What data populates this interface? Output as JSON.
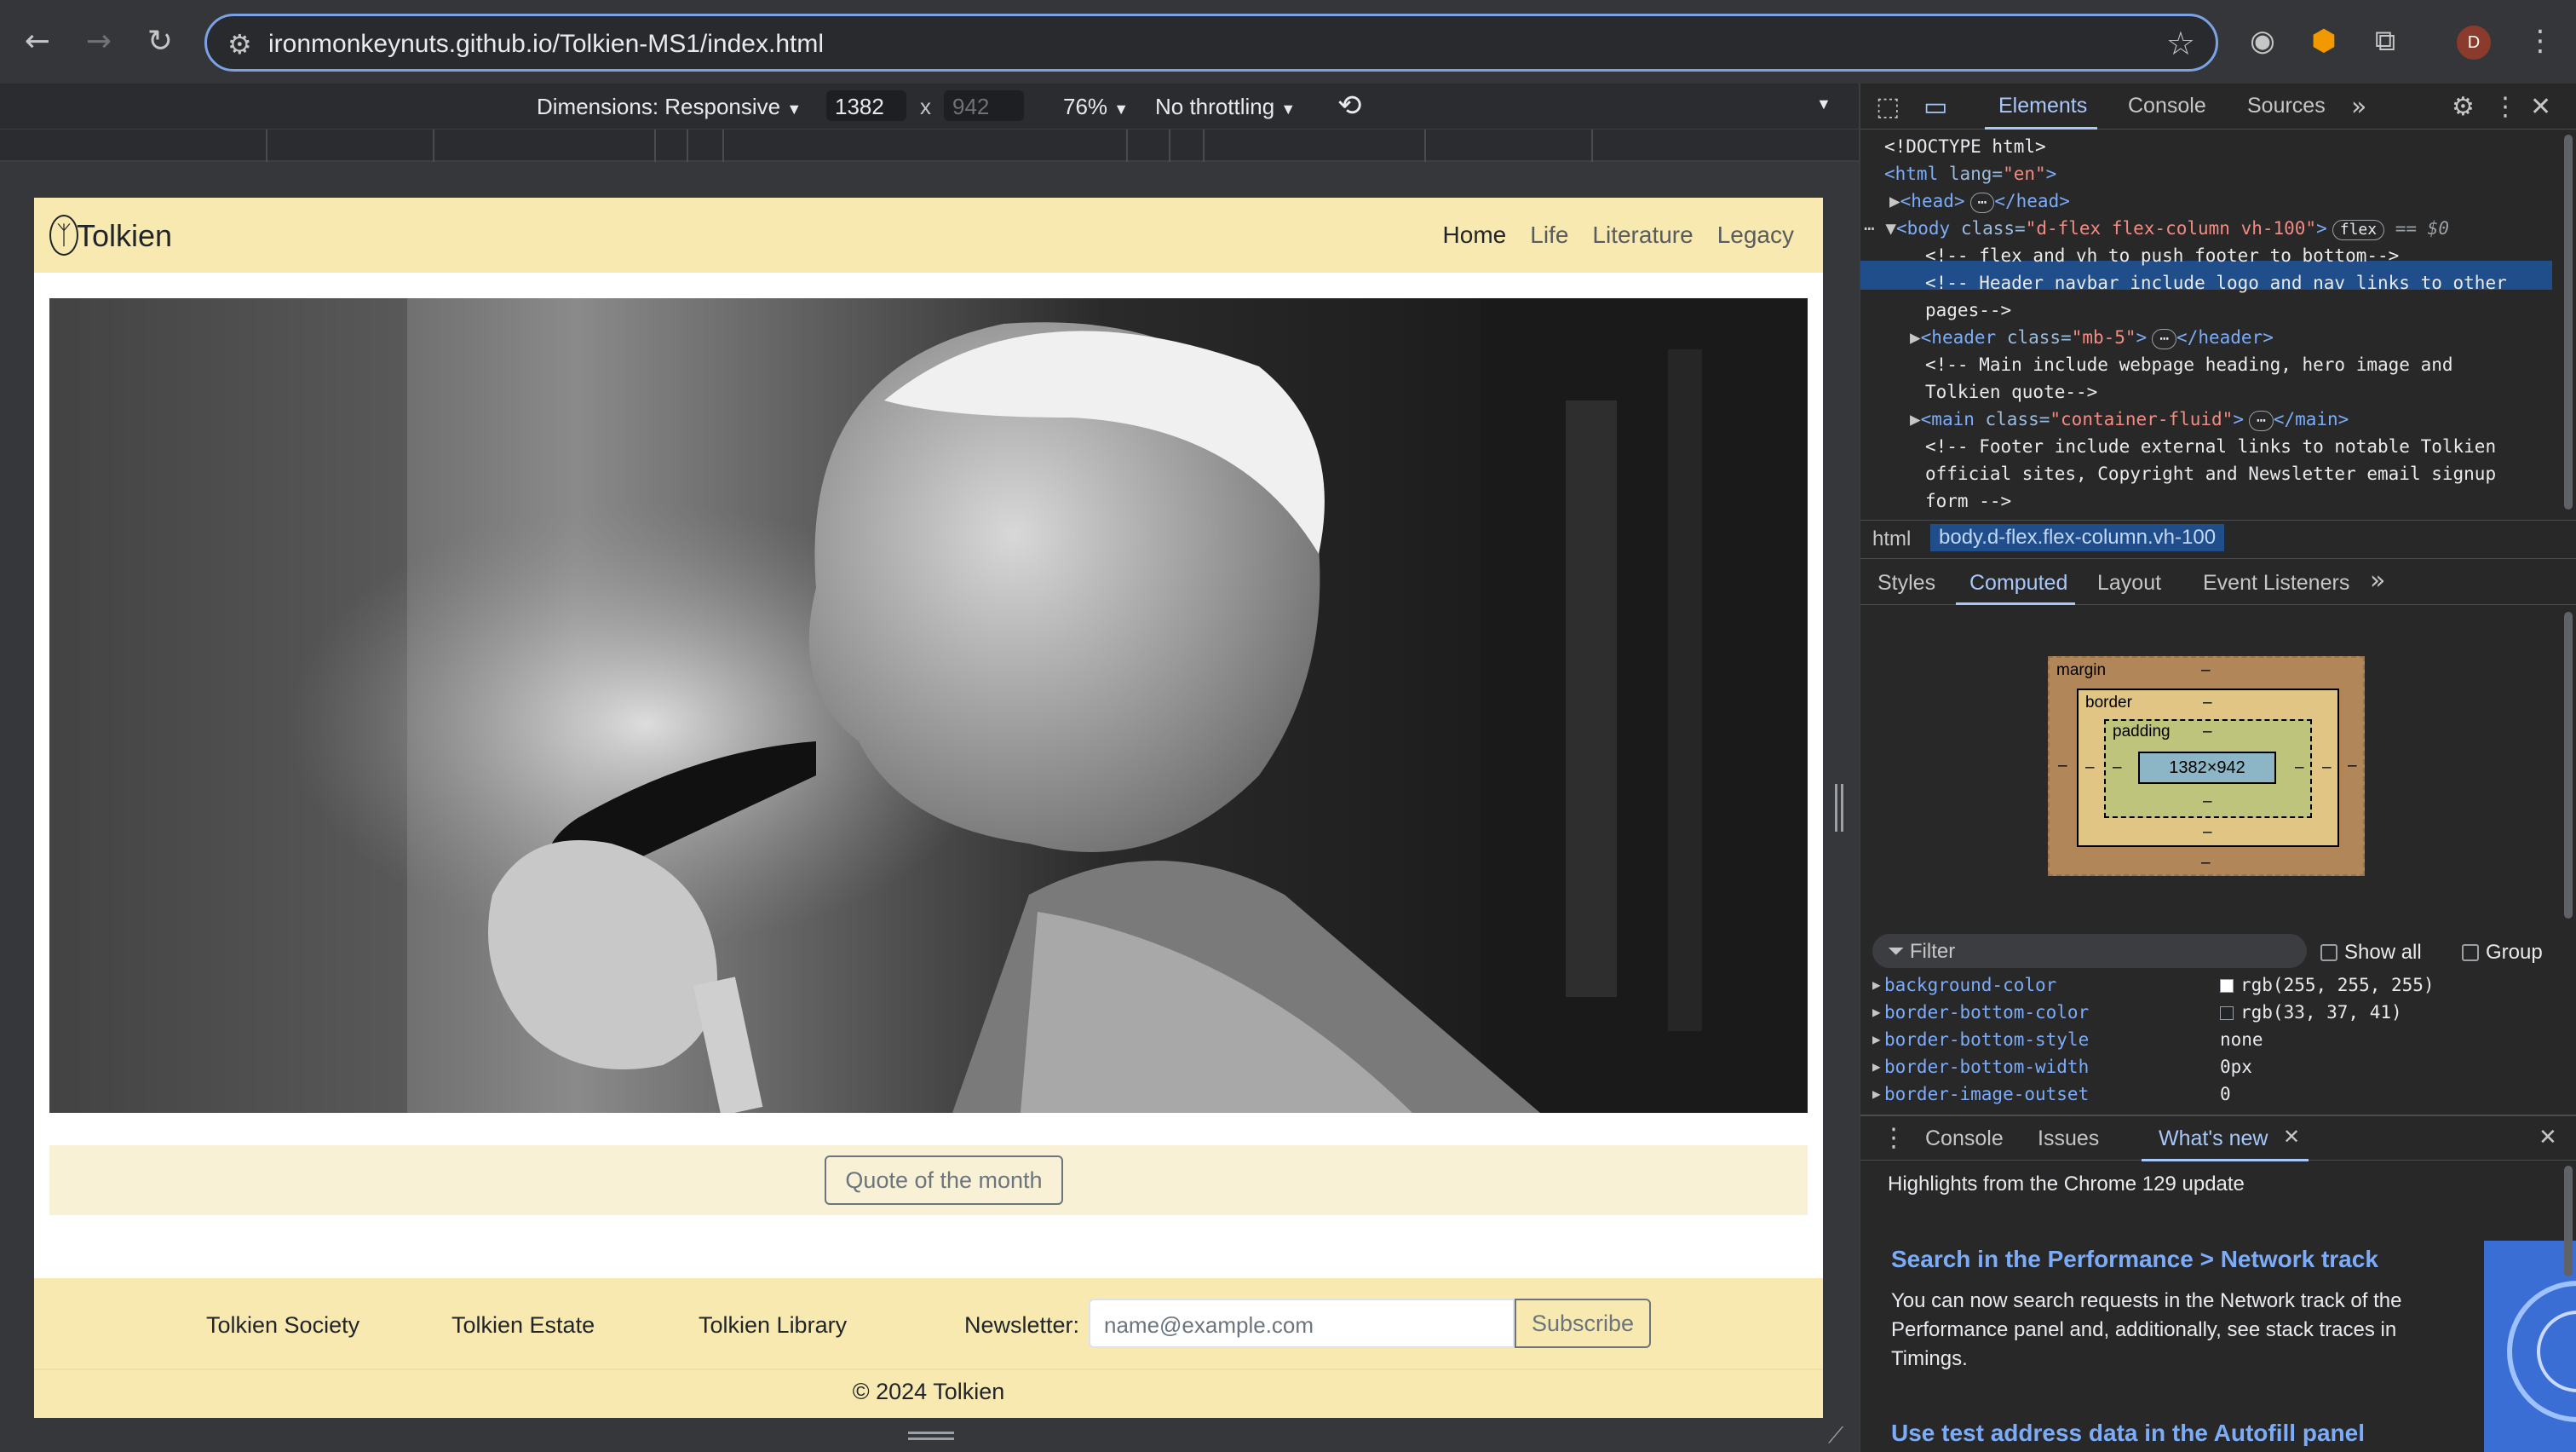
{
  "browser": {
    "url": "ironmonkeynuts.github.io/Tolkien-MS1/index.html",
    "avatar_initial": "D",
    "icons": {
      "back": "arrow-left-icon",
      "forward": "arrow-right-icon",
      "reload": "reload-icon",
      "site_info": "tune-icon",
      "bookmark": "star-icon",
      "screenshot": "camera-icon",
      "extension": "extension-icon",
      "extensions_menu": "puzzle-icon",
      "menu": "kebab-menu-icon"
    }
  },
  "device_toolbar": {
    "dimensions_label": "Dimensions: Responsive",
    "width": "1382",
    "height": "942",
    "times": "x",
    "zoom": "76%",
    "throttling": "No throttling"
  },
  "site": {
    "brand": "Tolkien",
    "nav": [
      {
        "label": "Home",
        "active": true
      },
      {
        "label": "Life",
        "active": false
      },
      {
        "label": "Literature",
        "active": false
      },
      {
        "label": "Legacy",
        "active": false
      }
    ],
    "quote_button": "Quote of the month",
    "footer_links": [
      "Tolkien Society",
      "Tolkien Estate",
      "Tolkien Library"
    ],
    "newsletter_label": "Newsletter:",
    "newsletter_placeholder": "name@example.com",
    "subscribe_label": "Subscribe",
    "copyright": "© 2024 Tolkien"
  },
  "devtools": {
    "tabs": [
      "Elements",
      "Console",
      "Sources"
    ],
    "active_tab": "Elements",
    "dom": {
      "doctype": "<!DOCTYPE html>",
      "html_open_tag": "<html",
      "html_lang_attr": " lang=",
      "html_lang_val": "\"en\"",
      "html_close_bracket": ">",
      "head": "<head>",
      "head_close": "</head>",
      "body_tag": "<body",
      "body_class_attr": " class=",
      "body_class_val": "\"d-flex flex-column vh-100\"",
      "body_close_bracket": ">",
      "flex_badge": "flex",
      "eq_s0": "== $0",
      "comment1": "<!-- flex and vh to push footer to bottom-->",
      "comment2a": "<!-- Header navbar include logo and nav links to other",
      "comment2b": "pages-->",
      "header_tag": "<header",
      "header_class_val": "\"mb-5\"",
      "header_close": "</header>",
      "comment3a": "<!-- Main include webpage heading, hero image and",
      "comment3b": "Tolkien quote-->",
      "main_tag": "<main",
      "main_class_val": "\"container-fluid\"",
      "main_close": "</main>",
      "comment4a": "<!-- Footer include external links to notable Tolkien",
      "comment4b": "official sites, Copyright and Newsletter email signup",
      "comment4c": "form -->"
    },
    "breadcrumbs": [
      "html",
      "body.d-flex.flex-column.vh-100"
    ],
    "sub_tabs": [
      "Styles",
      "Computed",
      "Layout",
      "Event Listeners"
    ],
    "active_sub_tab": "Computed",
    "box_model": {
      "margin_label": "margin",
      "border_label": "border",
      "padding_label": "padding",
      "content": "1382×942",
      "dash": "–"
    },
    "filter_placeholder": "Filter",
    "show_all": "Show all",
    "group": "Group",
    "properties": [
      {
        "name": "background-color",
        "value": "rgb(255, 255, 255)",
        "swatch": "#ffffff"
      },
      {
        "name": "border-bottom-color",
        "value": "rgb(33, 37, 41)",
        "swatch": "#212529"
      },
      {
        "name": "border-bottom-style",
        "value": "none"
      },
      {
        "name": "border-bottom-width",
        "value": "0px"
      },
      {
        "name": "border-image-outset",
        "value": "0"
      }
    ],
    "drawer_tabs": [
      "Console",
      "Issues",
      "What's new"
    ],
    "active_drawer_tab": "What's new",
    "whats_new": {
      "highlight": "Highlights from the Chrome 129 update",
      "title1": "Search in the Performance > Network track",
      "text1": "You can now search requests in the Network track of the Performance panel and, additionally, see stack traces in Timings.",
      "title2": "Use test address data in the Autofill panel"
    }
  }
}
